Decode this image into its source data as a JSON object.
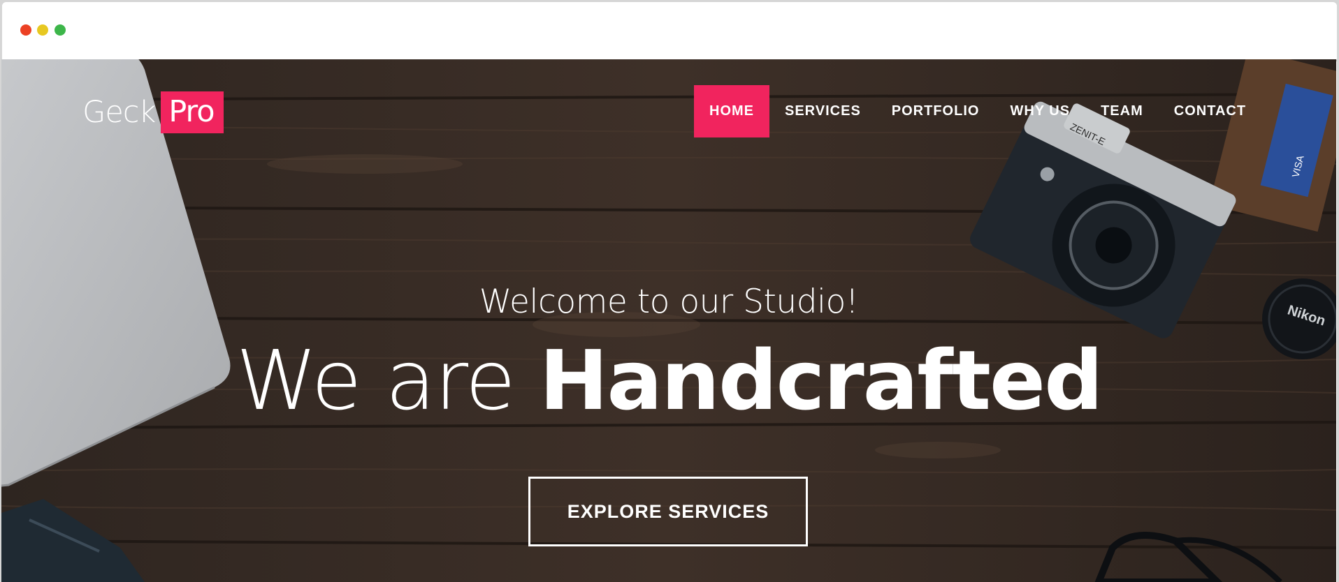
{
  "window": {
    "controls": [
      "close",
      "minimize",
      "maximize"
    ],
    "colors": {
      "close": "#ec4124",
      "minimize": "#e7c821",
      "maximize": "#3db64a"
    }
  },
  "header": {
    "logo": {
      "main": "Geck",
      "badge": "Pro"
    },
    "nav": {
      "items": [
        {
          "label": "HOME",
          "active": true
        },
        {
          "label": "SERVICES",
          "active": false
        },
        {
          "label": "PORTFOLIO",
          "active": false
        },
        {
          "label": "WHY US",
          "active": false
        },
        {
          "label": "TEAM",
          "active": false
        },
        {
          "label": "CONTACT",
          "active": false
        }
      ]
    }
  },
  "hero": {
    "subtitle": "Welcome to our Studio!",
    "headline_light": "We are",
    "headline_bold": "Handcrafted",
    "cta_label": "EXPLORE SERVICES",
    "camera_brand": "ZENIT-E",
    "lens_cap_brand": "Nikon",
    "card_brand": "VISA"
  },
  "colors": {
    "accent": "#f1245e",
    "background_wood": "#3b2d24",
    "text": "#ffffff"
  }
}
